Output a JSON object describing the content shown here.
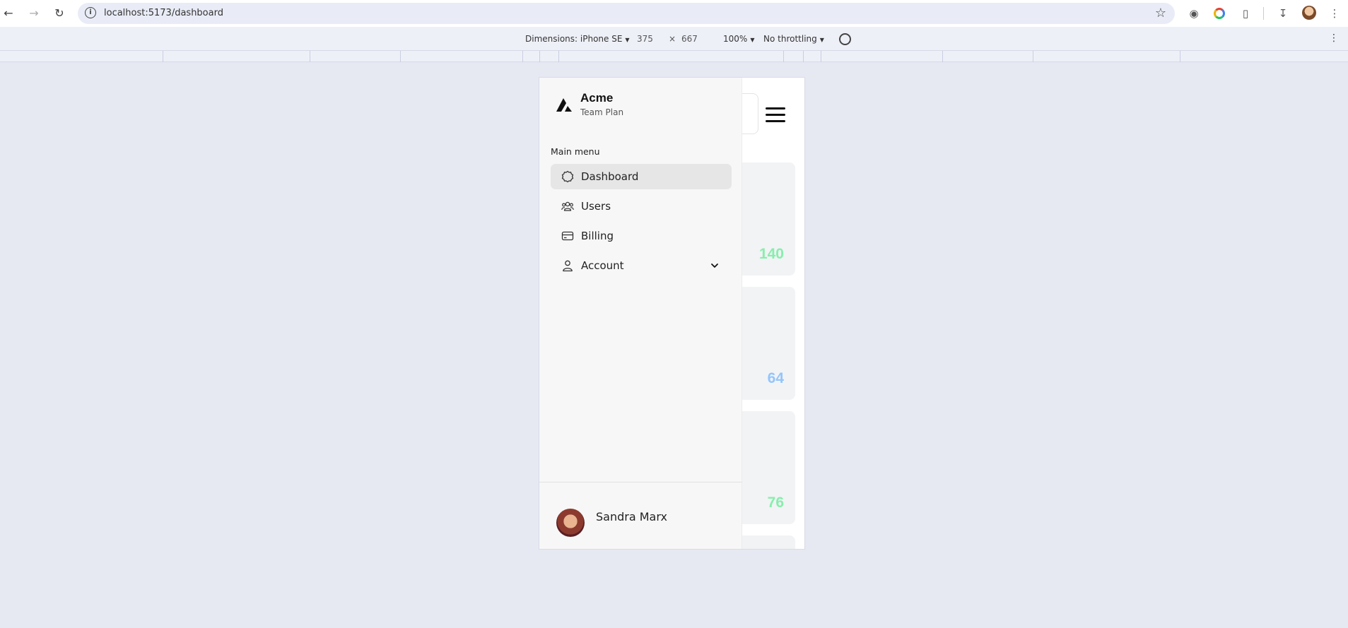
{
  "browser": {
    "url": "localhost:5173/dashboard"
  },
  "device_toolbar": {
    "dimensions_label": "Dimensions: iPhone SE",
    "width": "375",
    "times": "×",
    "height": "667",
    "zoom": "100%",
    "throttling": "No throttling"
  },
  "sidebar": {
    "brand": {
      "name": "Acme",
      "plan": "Team Plan"
    },
    "menu_title": "Main menu",
    "items": [
      {
        "label": "Dashboard",
        "icon": "dashboard-icon",
        "active": true
      },
      {
        "label": "Users",
        "icon": "users-icon",
        "active": false
      },
      {
        "label": "Billing",
        "icon": "billing-icon",
        "active": false
      },
      {
        "label": "Account",
        "icon": "account-icon",
        "active": false,
        "expandable": true
      }
    ],
    "user": {
      "name": "Sandra Marx"
    }
  },
  "cards": [
    {
      "value": "140",
      "color": "#86efac"
    },
    {
      "value": "64",
      "color": "#93c5fd"
    },
    {
      "value": "76",
      "color": "#86efac"
    }
  ],
  "colors": {
    "page_background": "#e6e8f2",
    "sidebar_background": "#f7f7f7",
    "active_item": "#e6e6e6"
  }
}
